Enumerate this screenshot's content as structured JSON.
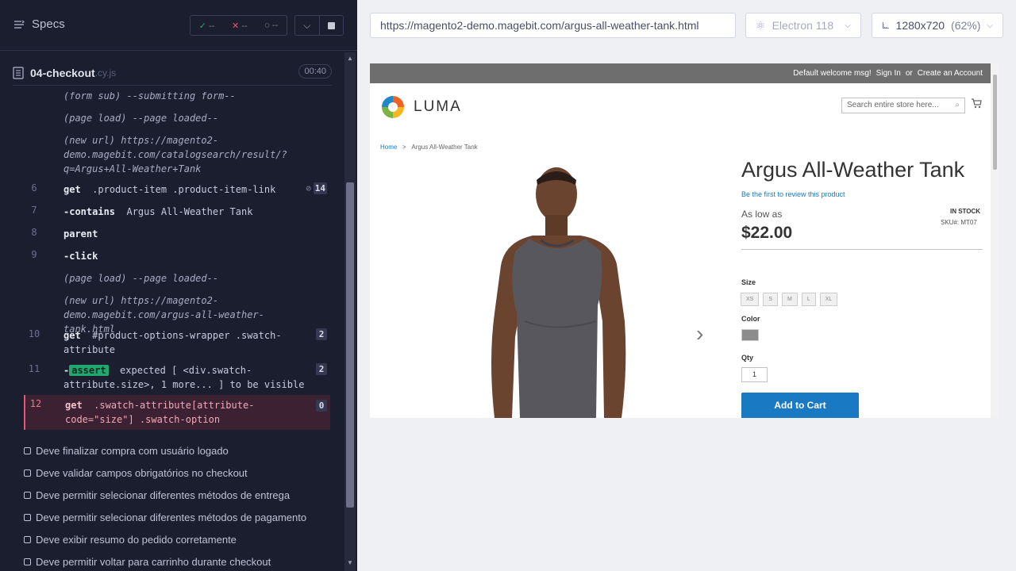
{
  "header": {
    "title": "Specs",
    "passed": "--",
    "failed": "--",
    "pending": "--"
  },
  "spec": {
    "name": "04-checkout",
    "ext": ".cy.js",
    "duration": "00:40"
  },
  "commands": [
    {
      "num": "",
      "text": "(form sub)  --submitting form--",
      "italic": true
    },
    {
      "num": "",
      "text": "(page load)  --page loaded--",
      "italic": true
    },
    {
      "num": "",
      "text": "(new url)  https://magento2-demo.magebit.com/catalogsearch/result/?q=Argus+All-Weather+Tank",
      "italic": true
    },
    {
      "num": "6",
      "name": "get",
      "arg": ".product-item .product-item-link",
      "count": "14"
    },
    {
      "num": "7",
      "name": "-contains",
      "arg": "Argus All-Weather Tank"
    },
    {
      "num": "8",
      "name": "parent",
      "arg": ""
    },
    {
      "num": "9",
      "name": "-click",
      "arg": ""
    },
    {
      "num": "",
      "text": "(page load)  --page loaded--",
      "italic": true
    },
    {
      "num": "",
      "text": "(new url)  https://magento2-demo.magebit.com/argus-all-weather-tank.html",
      "italic": true
    },
    {
      "num": "10",
      "name": "get",
      "arg": "#product-options-wrapper .swatch-attribute",
      "count": "2"
    },
    {
      "num": "11",
      "name": "-",
      "assert": "assert",
      "arg": "expected  [ <div.swatch-attribute.size>, 1 more... ]  to be  visible",
      "count": "2"
    },
    {
      "num": "12",
      "name": "get",
      "arg": ".swatch-attribute[attribute-code=\"size\"] .swatch-option",
      "count": "0"
    }
  ],
  "tests": [
    "Deve finalizar compra com usuário logado",
    "Deve validar campos obrigatórios no checkout",
    "Deve permitir selecionar diferentes métodos de entrega",
    "Deve permitir selecionar diferentes métodos de pagamento",
    "Deve exibir resumo do pedido corretamente",
    "Deve permitir voltar para carrinho durante checkout"
  ],
  "browser": {
    "url": "https://magento2-demo.magebit.com/argus-all-weather-tank.html",
    "name": "Electron 118",
    "viewport": "1280x720",
    "scale": "(62%)"
  },
  "store": {
    "welcome": "Default welcome msg!",
    "signin": "Sign In",
    "or": "or",
    "create": "Create an Account",
    "logo": "LUMA",
    "search_placeholder": "Search entire store here...",
    "crumb_home": "Home",
    "crumb_sep": ">",
    "crumb_current": "Argus All-Weather Tank",
    "product_title": "Argus All-Weather Tank",
    "review": "Be the first to review this product",
    "as_low_as": "As low as",
    "price": "$22.00",
    "stock": "IN STOCK",
    "sku": "SKU#:  MT07",
    "size_label": "Size",
    "sizes": [
      "XS",
      "S",
      "M",
      "L",
      "XL"
    ],
    "color_label": "Color",
    "qty_label": "Qty",
    "qty": "1",
    "add_to_cart": "Add to Cart"
  }
}
